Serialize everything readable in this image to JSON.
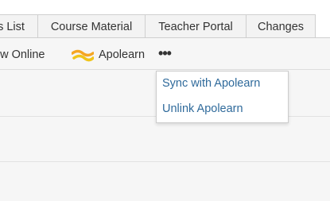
{
  "tabs": [
    {
      "label": "s List"
    },
    {
      "label": "Course Material"
    },
    {
      "label": "Teacher Portal"
    },
    {
      "label": "Changes"
    }
  ],
  "toolbar": {
    "view_online_label": "ew Online",
    "apolearn_label": "Apolearn",
    "more_label": "•••",
    "apolearn_icon": "apolearn-logo-icon",
    "apolearn_colors": [
      "#f5a623",
      "#f0c419"
    ]
  },
  "dropdown": {
    "items": [
      {
        "label": "Sync with Apolearn"
      },
      {
        "label": "Unlink Apolearn"
      }
    ],
    "link_color": "#2f6a9b"
  }
}
